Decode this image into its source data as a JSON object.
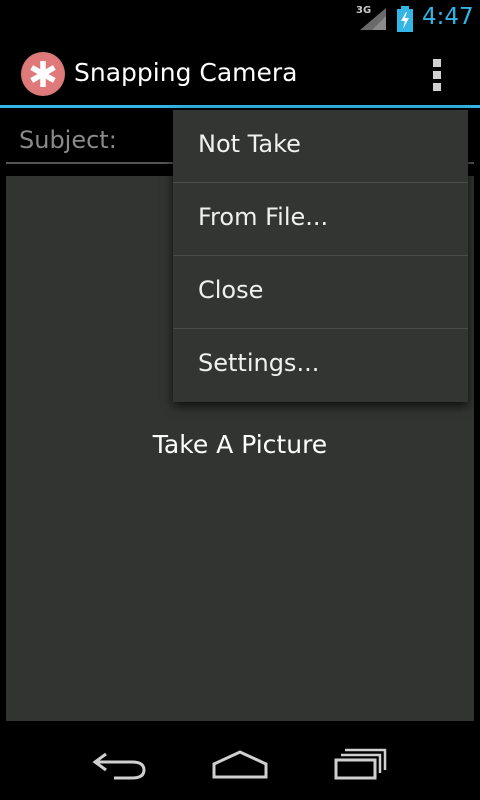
{
  "status_bar": {
    "network": "3G",
    "time": "4:47"
  },
  "action_bar": {
    "title": "Snapping Camera"
  },
  "form": {
    "subject_label": "Subject:"
  },
  "picture_area": {
    "label": "Take A Picture"
  },
  "menu": {
    "items": [
      {
        "label": "Not Take"
      },
      {
        "label": "From File..."
      },
      {
        "label": "Close"
      },
      {
        "label": "Settings..."
      }
    ]
  },
  "colors": {
    "accent": "#33b5e5",
    "app_icon": "#d97a7a",
    "content_bg": "#323432",
    "menu_bg": "#333533"
  },
  "icons": {
    "app": "asterisk-icon",
    "overflow": "overflow-menu-icon",
    "back": "back-icon",
    "home": "home-icon",
    "recent": "recent-apps-icon"
  }
}
